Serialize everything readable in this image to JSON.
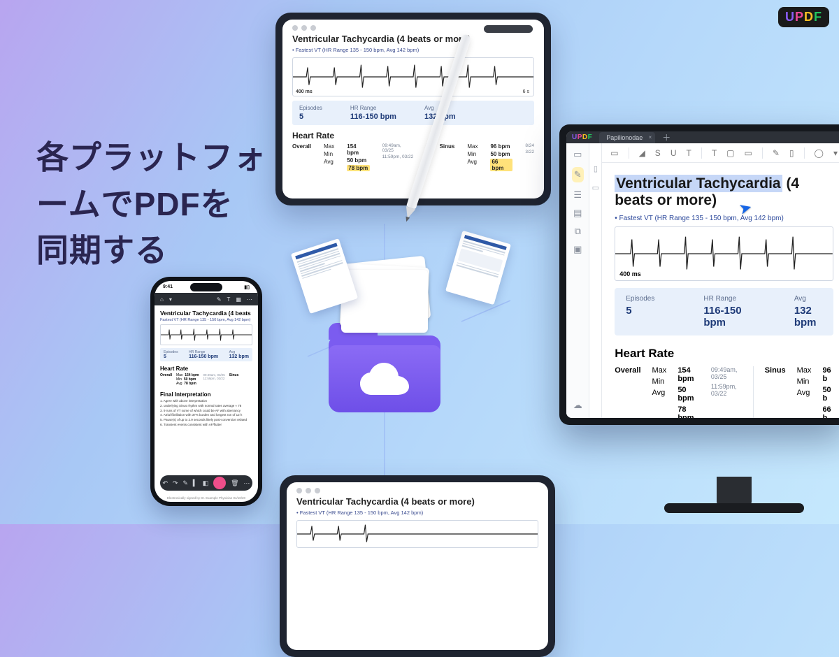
{
  "brand": {
    "name": "UPDF",
    "letters": [
      "U",
      "P",
      "D",
      "F"
    ]
  },
  "headline": {
    "line1": "各プラットフォ",
    "line2": "ームでPDFを",
    "line3": "同期する"
  },
  "document": {
    "title": "Ventricular Tachycardia (4 beats or more)",
    "subtitle": "Fastest VT (HR Range 135 - 150 bpm, Avg 142 bpm)",
    "ecg_left_label": "400 ms",
    "ecg_right_label": "6 s",
    "stats": {
      "episodes": {
        "label": "Episodes",
        "value": "5"
      },
      "hr_range": {
        "label": "HR Range",
        "value": "116-150 bpm"
      },
      "avg": {
        "label": "Avg",
        "value": "132 bpm"
      }
    },
    "heart_rate_title": "Heart Rate",
    "heart_rate": {
      "overall_label": "Overall",
      "sinus_label": "Sinus",
      "rows": [
        "Max",
        "Min",
        "Avg"
      ],
      "overall": {
        "max": "154 bpm",
        "min": "50 bpm",
        "avg": "78 bpm",
        "max_ts": "09:49am, 03/25",
        "min_ts": "11:59pm, 03/22"
      },
      "sinus": {
        "max": "96 bpm",
        "min": "50 bpm",
        "avg": "66 bpm",
        "max_ts": "8/24",
        "min_ts": "3/22"
      }
    },
    "final_title": "Final Interpretation",
    "final_lines": [
      "1. Agree with above interpretation",
      "2. underlying Sinus rhythm with normal rates average ≈ 78",
      "3. 9 runs of VT some of which could be AF with aberrancy",
      "4. Atrial fibrillation with 37% burden and longest run of 12 h",
      "5. Pause(s) of up to 2.9 seconds likely post-conversion related",
      "6. Transient events consistent with AF/flutter"
    ],
    "signed": "Electronically signed by Dr. Example Physician 04/10/20"
  },
  "iphone": {
    "time": "9:41"
  },
  "desktop": {
    "tab_name": "Papilionodae",
    "selected_text": "Ventricular Tachycardia",
    "title_rest": " (4 beats or more)"
  }
}
